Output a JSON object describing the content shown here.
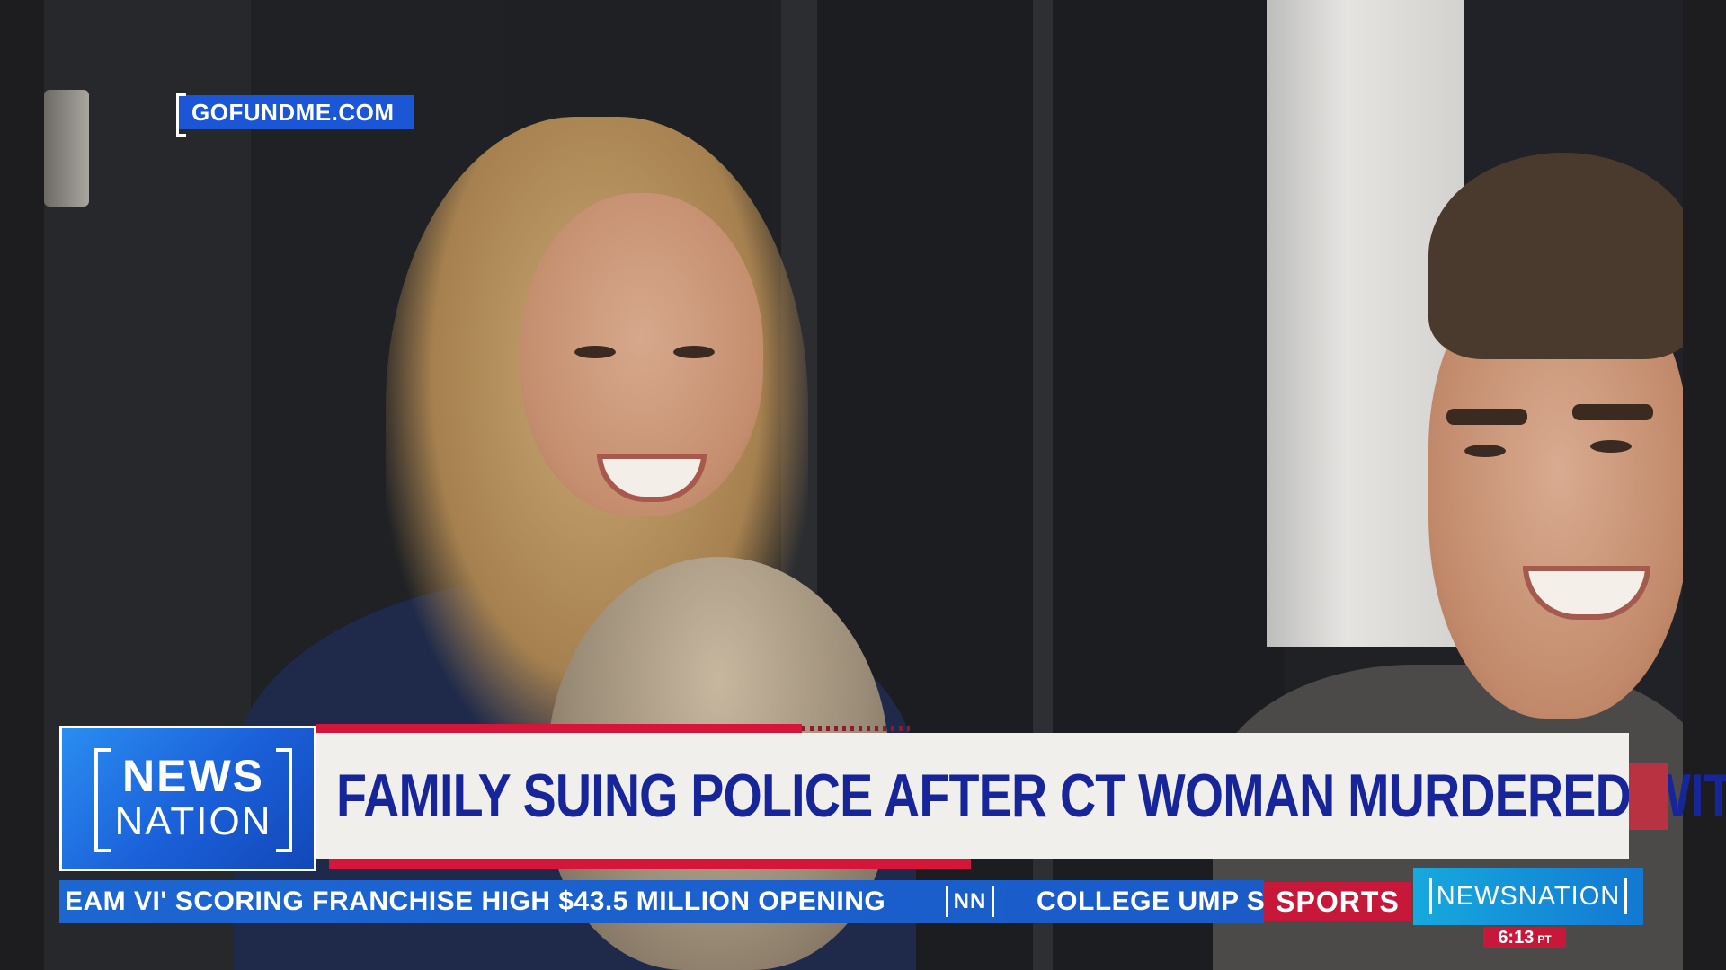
{
  "source": {
    "label": "GOFUNDME.COM"
  },
  "logo": {
    "line1": "NEWS",
    "line2": "NATION"
  },
  "headline": {
    "text": "FAMILY SUING POLICE AFTER CT WOMAN MURDERED WITH AX"
  },
  "ticker": {
    "items": [
      "EAM VI' SCORING FRANCHISE HIGH $43.5 MILLION OPENING",
      "COLLEGE UMP S"
    ],
    "separator": "NN",
    "category": "SPORTS"
  },
  "brand": {
    "label": "NEWSNATION"
  },
  "clock": {
    "time": "6:13",
    "timezone": "PT"
  },
  "colors": {
    "headline_text": "#16259a",
    "accent_red": "#d5163a",
    "ticker_blue": "#1a5bc8",
    "source_tag_blue": "#1a56d6"
  }
}
